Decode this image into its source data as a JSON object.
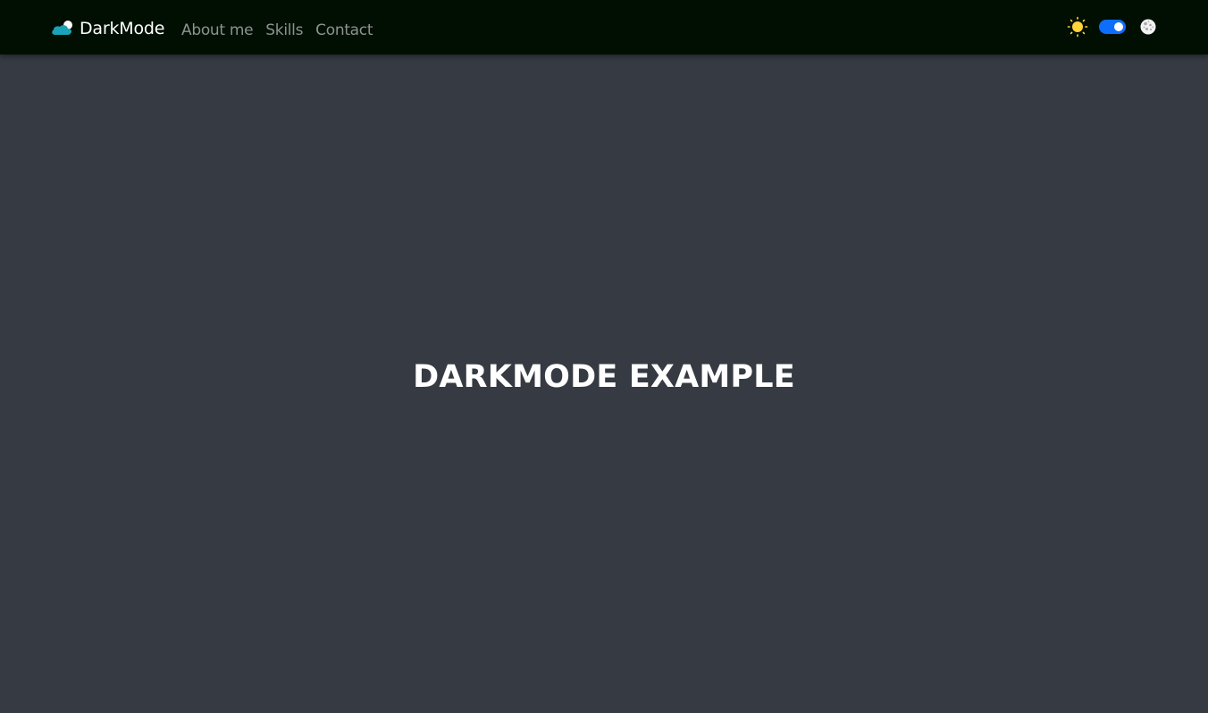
{
  "navbar": {
    "brand": {
      "text": "DarkMode",
      "icon": "cloud-sun-icon"
    },
    "links": [
      {
        "label": "About me"
      },
      {
        "label": "Skills"
      },
      {
        "label": "Contact"
      }
    ],
    "theme_switch": {
      "light_icon": "sun-icon",
      "dark_icon": "moon-icon",
      "checked": true
    }
  },
  "main": {
    "title": "DARKMODE EXAMPLE"
  },
  "colors": {
    "navbar_bg": "#010f03",
    "page_bg": "#363a42",
    "brand_icon": "#1aa3b8",
    "toggle_accent": "#0d6efd",
    "sun": "#ffd43b",
    "nav_link": "#8d9290",
    "title": "#ffffff"
  }
}
